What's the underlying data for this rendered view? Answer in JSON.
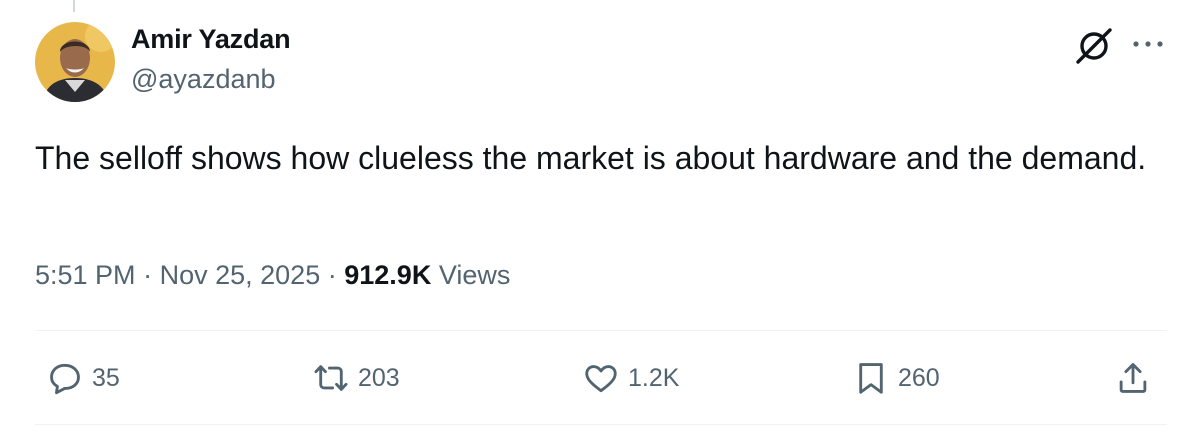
{
  "author": {
    "name": "Amir Yazdan",
    "handle": "@ayazdanb"
  },
  "tweet": {
    "text": "The selloff shows how clueless the market is about hardware and the demand."
  },
  "meta": {
    "time": "5:51 PM",
    "separator": "·",
    "date": "Nov 25, 2025",
    "views_count": "912.9K",
    "views_label": "Views"
  },
  "actions": {
    "replies": "35",
    "reposts": "203",
    "likes": "1.2K",
    "bookmarks": "260"
  },
  "icons": {
    "header": [
      "grok-icon",
      "more-icon"
    ],
    "actions": [
      "reply-icon",
      "repost-icon",
      "like-icon",
      "bookmark-icon",
      "share-icon"
    ]
  },
  "colors": {
    "text_primary": "#0f1419",
    "text_secondary": "#536471",
    "divider": "#eff3f4",
    "avatar_bg": "#e8b74a"
  }
}
